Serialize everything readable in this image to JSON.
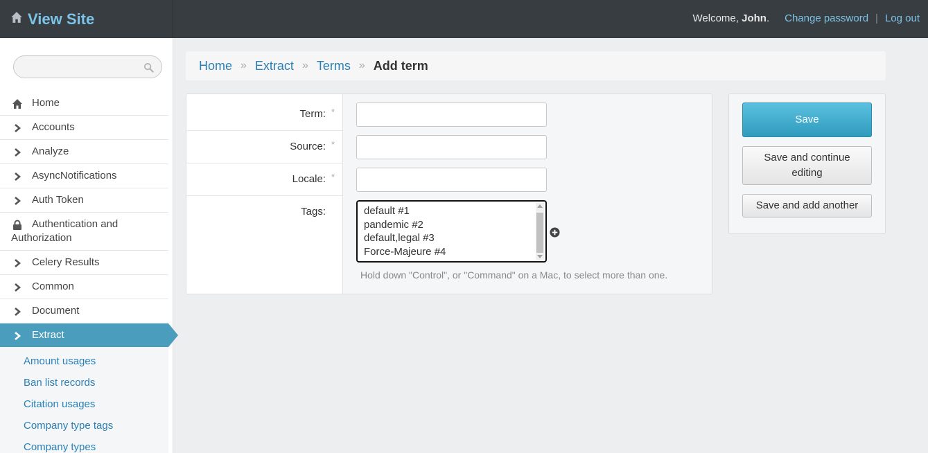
{
  "header": {
    "site_title": "View Site",
    "welcome_prefix": "Welcome,",
    "user_name": "John",
    "welcome_suffix": ".",
    "change_password": "Change password",
    "separator": "|",
    "logout": "Log out"
  },
  "sidebar": {
    "search": {
      "value": "",
      "placeholder": ""
    },
    "items": [
      {
        "label": "Home",
        "icon": "home-icon"
      },
      {
        "label": "Accounts",
        "icon": "chevron-right-icon"
      },
      {
        "label": "Analyze",
        "icon": "chevron-right-icon"
      },
      {
        "label": "AsyncNotifications",
        "icon": "chevron-right-icon"
      },
      {
        "label": "Auth Token",
        "icon": "chevron-right-icon"
      },
      {
        "label": "Authentication and Authorization",
        "icon": "lock-icon"
      },
      {
        "label": "Celery Results",
        "icon": "chevron-right-icon"
      },
      {
        "label": "Common",
        "icon": "chevron-right-icon"
      },
      {
        "label": "Document",
        "icon": "chevron-right-icon"
      },
      {
        "label": "Extract",
        "icon": "chevron-right-icon",
        "active": true
      }
    ],
    "subitems": [
      "Amount usages",
      "Ban list records",
      "Citation usages",
      "Company type tags",
      "Company types"
    ]
  },
  "breadcrumb": {
    "items": [
      "Home",
      "Extract",
      "Terms"
    ],
    "separator": "»",
    "current": "Add term"
  },
  "form": {
    "term_label": "Term:",
    "source_label": "Source:",
    "locale_label": "Locale:",
    "tags_label": "Tags:",
    "required_mark": "*",
    "term_value": "",
    "source_value": "",
    "locale_value": "",
    "tags_options": [
      "default #1",
      "pandemic #2",
      "default,legal #3",
      "Force-Majeure #4"
    ],
    "help_text": "Hold down \"Control\", or \"Command\" on a Mac, to select more than one."
  },
  "actions": {
    "save": "Save",
    "save_continue": "Save and continue editing",
    "save_add": "Save and add another"
  },
  "colors": {
    "header_bg": "#383d41",
    "link": "#2a7fb5",
    "brand": "#7cc3e8",
    "active_nav": "#4a9dbd",
    "primary_button": "#2f9bbd"
  }
}
